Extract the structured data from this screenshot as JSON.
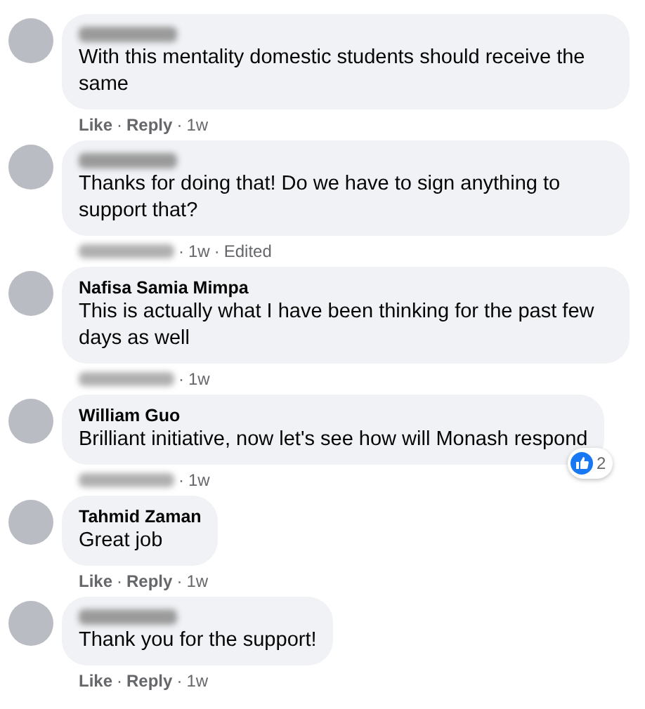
{
  "comments": [
    {
      "author_blurred": true,
      "text": "With this mentality domestic students should receive the same",
      "meta": [
        {
          "kind": "link",
          "text": "Like"
        },
        {
          "kind": "sep",
          "text": "·"
        },
        {
          "kind": "link",
          "text": "Reply"
        },
        {
          "kind": "sep",
          "text": "·"
        },
        {
          "kind": "time",
          "text": "1w"
        }
      ]
    },
    {
      "author_blurred": true,
      "text": "Thanks for doing that! Do we have to sign anything to support that?",
      "meta": [
        {
          "kind": "blur"
        },
        {
          "kind": "sep",
          "text": "·"
        },
        {
          "kind": "time",
          "text": "1w"
        },
        {
          "kind": "sep",
          "text": "·"
        },
        {
          "kind": "note",
          "text": "Edited"
        }
      ]
    },
    {
      "author": "Nafisa Samia Mimpa",
      "text": "This is actually what I have been thinking for the past few days as well",
      "meta": [
        {
          "kind": "blur"
        },
        {
          "kind": "sep",
          "text": "·"
        },
        {
          "kind": "time",
          "text": "1w"
        }
      ]
    },
    {
      "author": "William Guo",
      "text": "Brilliant initiative, now let's see how will Monash respond",
      "reactions": {
        "count": "2"
      },
      "meta": [
        {
          "kind": "blur"
        },
        {
          "kind": "sep",
          "text": "·"
        },
        {
          "kind": "time",
          "text": "1w"
        }
      ]
    },
    {
      "author": "Tahmid Zaman",
      "text": "Great job",
      "meta": [
        {
          "kind": "link",
          "text": "Like"
        },
        {
          "kind": "sep",
          "text": "·"
        },
        {
          "kind": "link",
          "text": "Reply"
        },
        {
          "kind": "sep",
          "text": "·"
        },
        {
          "kind": "time",
          "text": "1w"
        }
      ]
    },
    {
      "author_blurred": true,
      "text": "Thank you for the support!",
      "meta": [
        {
          "kind": "link",
          "text": "Like"
        },
        {
          "kind": "sep",
          "text": "·"
        },
        {
          "kind": "link",
          "text": "Reply"
        },
        {
          "kind": "sep",
          "text": "·"
        },
        {
          "kind": "time",
          "text": "1w"
        }
      ]
    }
  ]
}
